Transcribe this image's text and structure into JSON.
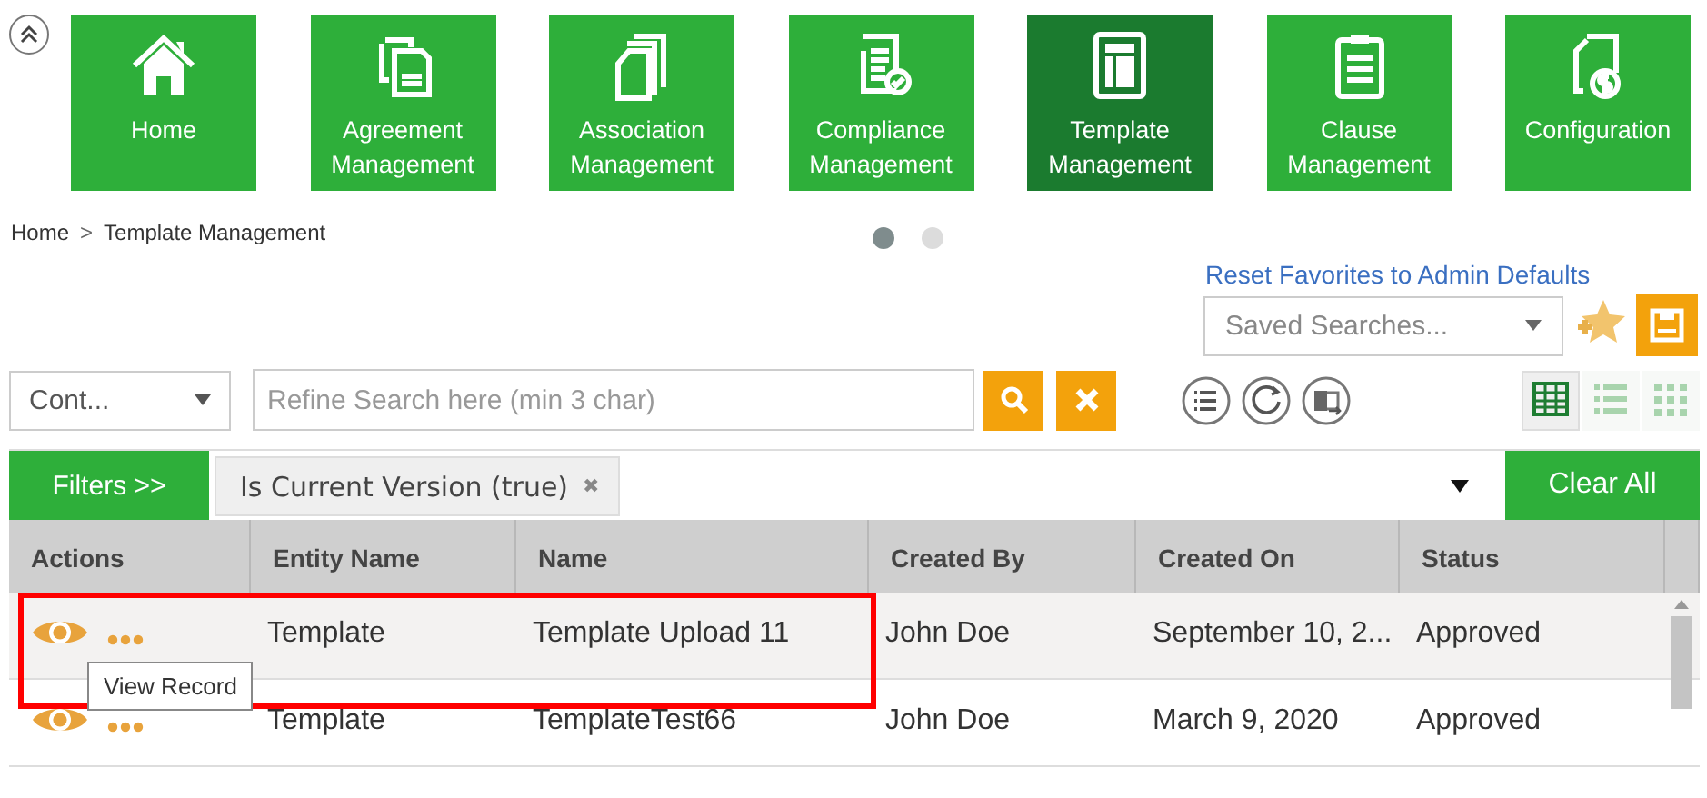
{
  "tiles": [
    {
      "label": "Home",
      "kind": "home",
      "selected": false
    },
    {
      "label": "Agreement Management",
      "kind": "docs",
      "selected": false
    },
    {
      "label": "Association Management",
      "kind": "pages",
      "selected": false
    },
    {
      "label": "Compliance Management",
      "kind": "check",
      "selected": false
    },
    {
      "label": "Template Management",
      "kind": "template",
      "selected": true
    },
    {
      "label": "Clause Management",
      "kind": "clipboard",
      "selected": false
    },
    {
      "label": "Configuration",
      "kind": "money",
      "selected": false
    }
  ],
  "breadcrumb": {
    "home": "Home",
    "separator": ">",
    "current": "Template Management"
  },
  "pager_dots": [
    {
      "selected": true
    },
    {
      "selected": false
    }
  ],
  "reset_link": "Reset Favorites to Admin Defaults",
  "saved_searches": {
    "placeholder": "Saved Searches..."
  },
  "scope_dropdown": {
    "value": "Cont..."
  },
  "search": {
    "placeholder": "Refine Search here (min 3 char)"
  },
  "view_modes": [
    {
      "kind": "grid",
      "selected": true
    },
    {
      "kind": "list",
      "selected": false
    },
    {
      "kind": "tiles",
      "selected": false
    }
  ],
  "filters": {
    "button": "Filters >>",
    "chips": [
      {
        "label": "Is Current Version (true)",
        "remove": "✖"
      }
    ],
    "clear": "Clear All"
  },
  "table": {
    "columns": [
      "Actions",
      "Entity Name",
      "Name",
      "Created By",
      "Created On",
      "Status"
    ],
    "rows": [
      {
        "selected": true,
        "cells": [
          "",
          "Template",
          "Template Upload 11",
          "John Doe",
          "September 10, 2...",
          "Approved"
        ]
      },
      {
        "selected": false,
        "cells": [
          "",
          "Template",
          "TemplateTest66",
          "John Doe",
          "March 9, 2020",
          "Approved"
        ]
      }
    ]
  },
  "tooltip": "View Record"
}
